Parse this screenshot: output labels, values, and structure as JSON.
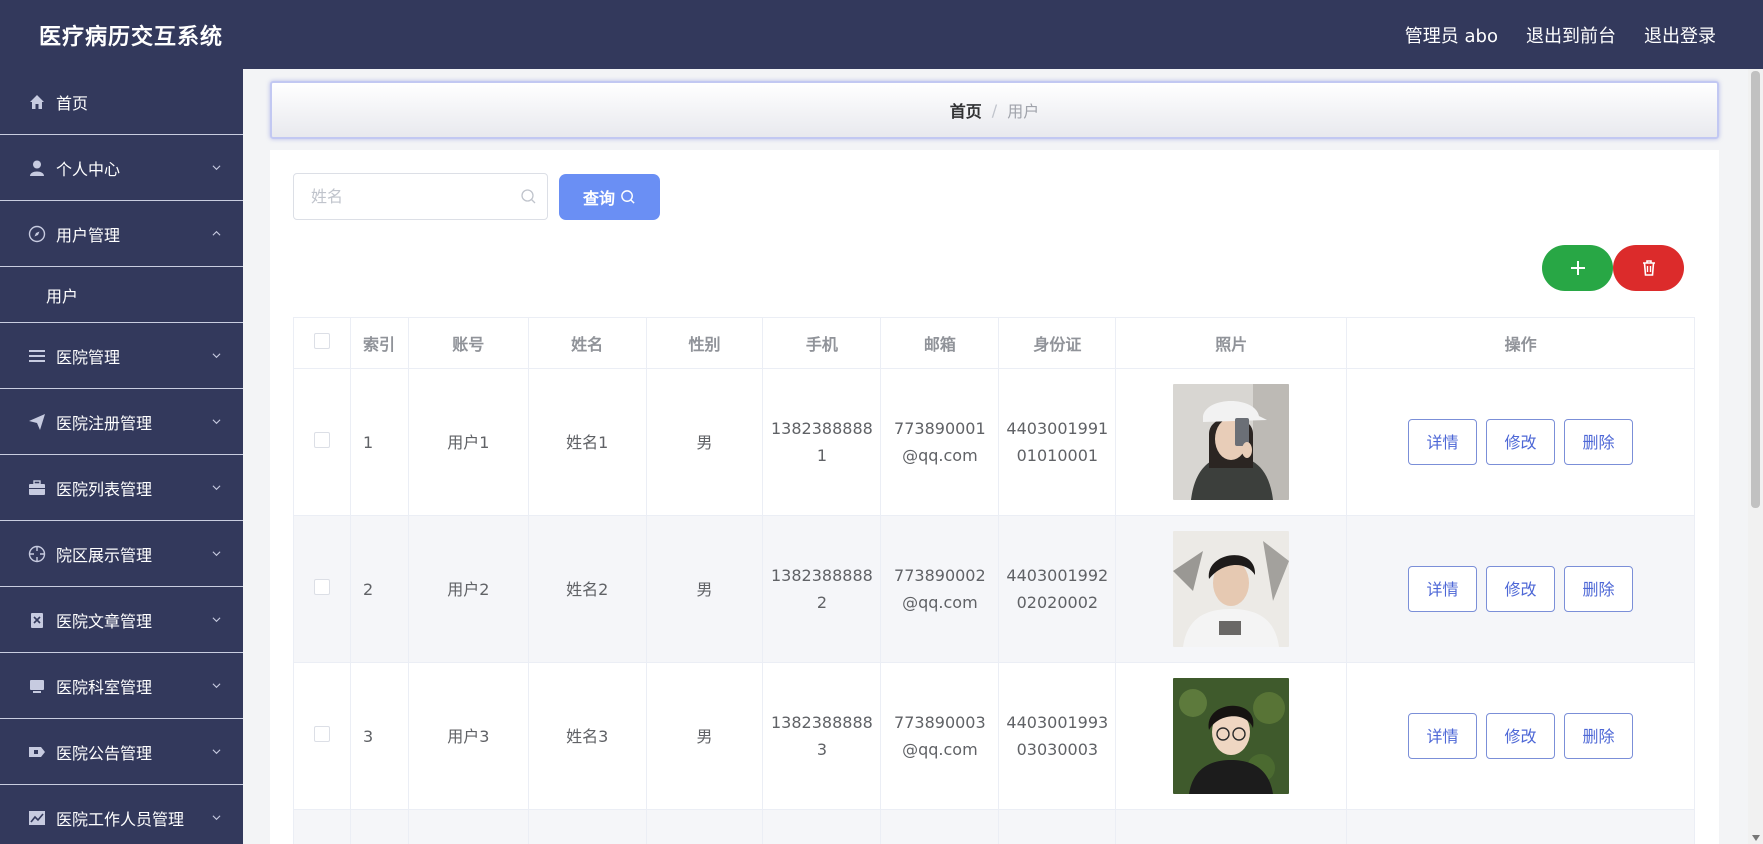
{
  "header": {
    "app_title": "医疗病历交互系统",
    "admin_label": "管理员 abo",
    "front_link": "退出到前台",
    "logout_link": "退出登录"
  },
  "sidebar": {
    "items": [
      {
        "label": "首页",
        "icon": "home-icon"
      },
      {
        "label": "个人中心",
        "icon": "user-icon"
      },
      {
        "label": "用户管理",
        "icon": "compass-icon",
        "expanded": true
      },
      {
        "label": "医院管理",
        "icon": "list-icon"
      },
      {
        "label": "医院注册管理",
        "icon": "send-icon"
      },
      {
        "label": "医院列表管理",
        "icon": "briefcase-icon"
      },
      {
        "label": "院区展示管理",
        "icon": "crosshair-icon"
      },
      {
        "label": "医院文章管理",
        "icon": "document-icon"
      },
      {
        "label": "医院科室管理",
        "icon": "monitor-icon"
      },
      {
        "label": "医院公告管理",
        "icon": "ticket-icon"
      },
      {
        "label": "医院工作人员管理",
        "icon": "chart-icon"
      }
    ],
    "sub_item": "用户"
  },
  "breadcrumb": {
    "home": "首页",
    "separator": "/",
    "current": "用户"
  },
  "search": {
    "placeholder": "姓名",
    "button_label": "查询"
  },
  "table": {
    "columns": [
      "索引",
      "账号",
      "姓名",
      "性别",
      "手机",
      "邮箱",
      "身份证",
      "照片",
      "操作"
    ],
    "rows": [
      {
        "index": "1",
        "account": "用户1",
        "name": "姓名1",
        "gender": "男",
        "phone_1": "1382388888",
        "phone_2": "1",
        "email_1": "773890001",
        "email_2": "@qq.com",
        "id_1": "4403001991",
        "id_2": "01010001"
      },
      {
        "index": "2",
        "account": "用户2",
        "name": "姓名2",
        "gender": "男",
        "phone_1": "1382388888",
        "phone_2": "2",
        "email_1": "773890002",
        "email_2": "@qq.com",
        "id_1": "4403001992",
        "id_2": "02020002"
      },
      {
        "index": "3",
        "account": "用户3",
        "name": "姓名3",
        "gender": "男",
        "phone_1": "1382388888",
        "phone_2": "3",
        "email_1": "773890003",
        "email_2": "@qq.com",
        "id_1": "4403001993",
        "id_2": "03030003"
      }
    ],
    "actions": {
      "detail": "详情",
      "edit": "修改",
      "delete": "删除"
    }
  },
  "colors": {
    "topbar": "#33395c",
    "query_button": "#6a8ff4",
    "add_button": "#28a745",
    "delete_button": "#dc2b2b"
  }
}
